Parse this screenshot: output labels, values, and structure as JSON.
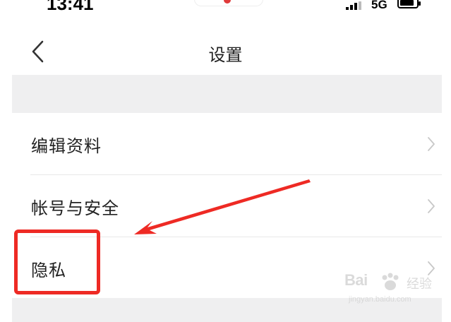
{
  "status_bar": {
    "time": "13:41",
    "network": "5G",
    "battery_level": 0.85,
    "signal_bars_filled": 3
  },
  "header": {
    "title": "设置",
    "back_icon": "chevron-left-icon"
  },
  "settings": {
    "items": [
      {
        "label": "编辑资料",
        "icon": "chevron-right-icon"
      },
      {
        "label": "帐号与安全",
        "icon": "chevron-right-icon"
      },
      {
        "label": "隐私",
        "icon": "chevron-right-icon"
      }
    ]
  },
  "annotation": {
    "color": "#ee2a24",
    "highlighted_item": "隐私"
  },
  "watermark": {
    "brand": "Bai",
    "brand_suffix": "经验",
    "url": "jingyan.baidu.com"
  }
}
